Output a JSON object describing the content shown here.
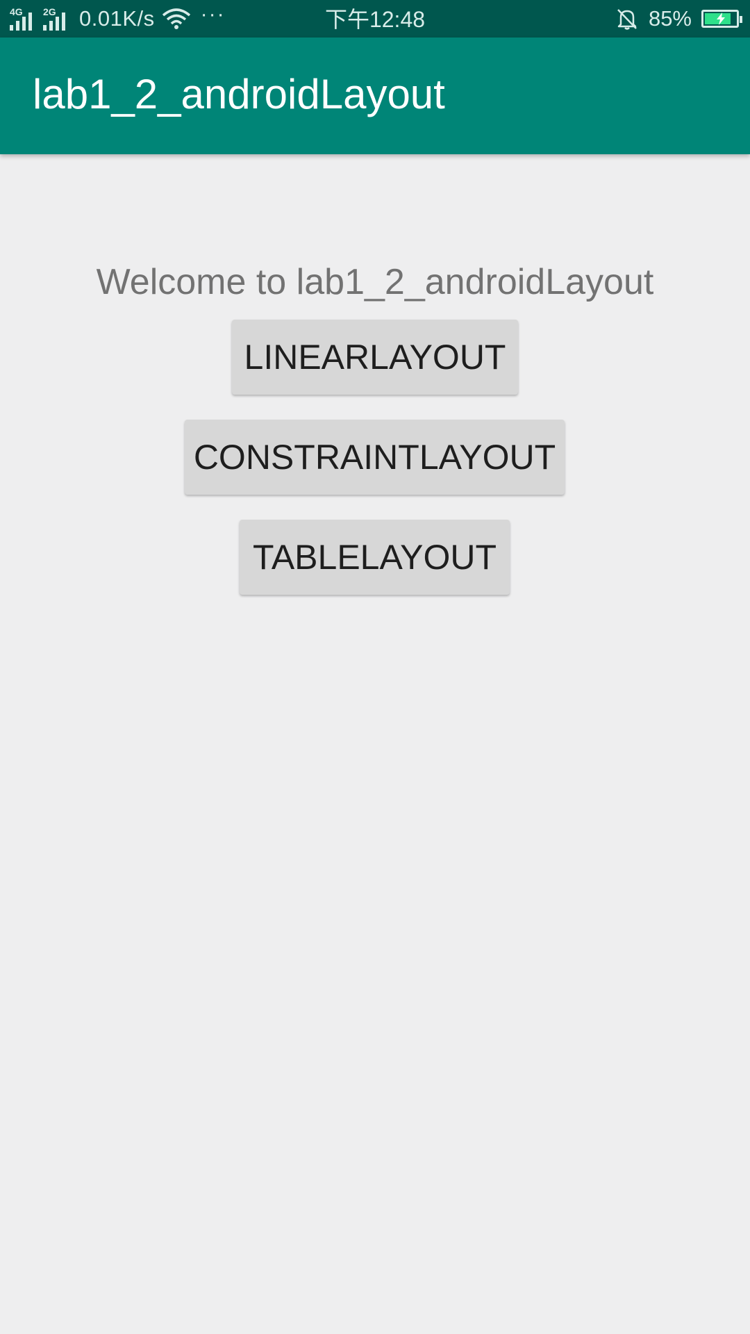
{
  "status_bar": {
    "signal1_label": "4G",
    "signal2_label": "2G",
    "speed": "0.01K/s",
    "more": "···",
    "time": "下午12:48",
    "battery_percent": "85%",
    "battery_level": 0.85,
    "icons": [
      "signal-icon",
      "wifi-icon",
      "more-icon",
      "bell-muted-icon",
      "battery-charging-icon"
    ]
  },
  "app_bar": {
    "title": "lab1_2_androidLayout",
    "color": "#008577",
    "status_color": "#00574E"
  },
  "main": {
    "welcome": "Welcome to lab1_2_androidLayout",
    "buttons": [
      {
        "label": "LINEARLAYOUT"
      },
      {
        "label": "CONSTRAINTLAYOUT"
      },
      {
        "label": "TABLELAYOUT"
      }
    ]
  }
}
